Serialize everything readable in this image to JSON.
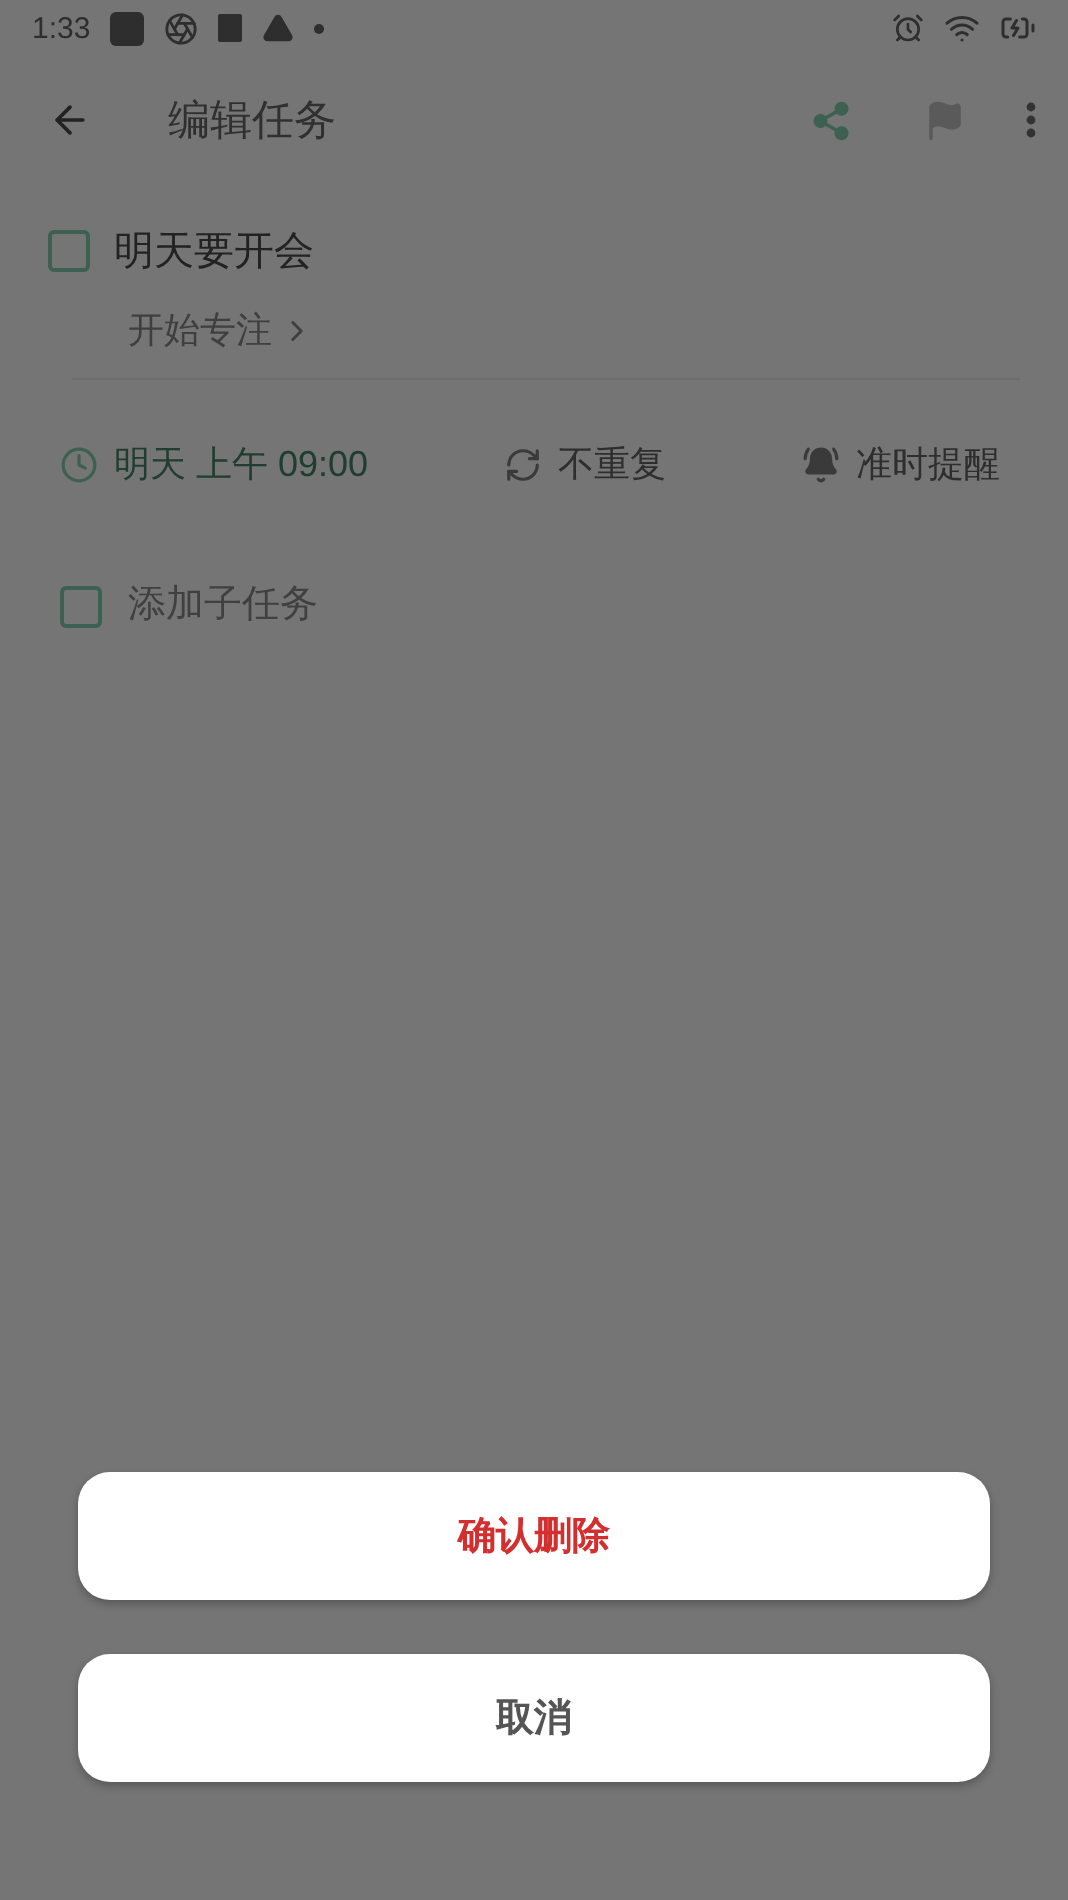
{
  "status_bar": {
    "time": "1:33"
  },
  "toolbar": {
    "title": "编辑任务"
  },
  "task": {
    "title": "明天要开会",
    "checked": false,
    "focus_link": "开始专注"
  },
  "options": [
    {
      "kind": "due",
      "label": "明天 上午 09:00"
    },
    {
      "kind": "repeat",
      "label": "不重复"
    },
    {
      "kind": "reminder",
      "label": "准时提醒"
    }
  ],
  "subtask": {
    "placeholder": "添加子任务",
    "checked": false
  },
  "action_sheet": {
    "actions": [
      {
        "label": "确认删除",
        "kind": "destructive"
      },
      {
        "label": "取消",
        "kind": "cancel"
      }
    ]
  }
}
